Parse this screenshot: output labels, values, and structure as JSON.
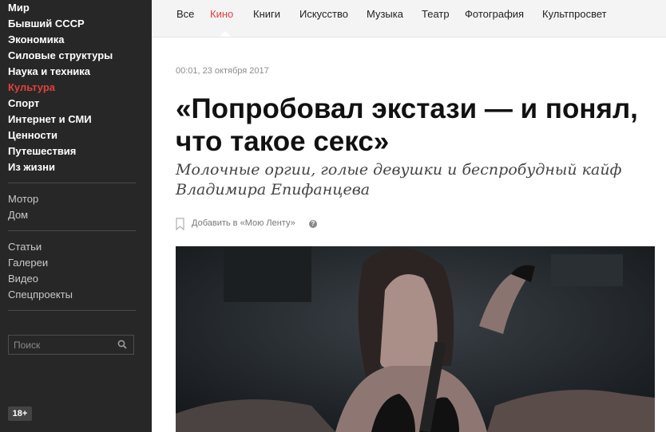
{
  "sidebar": {
    "sections": [
      "Мир",
      "Бывший СССР",
      "Экономика",
      "Силовые структуры",
      "Наука и техника",
      "Культура",
      "Спорт",
      "Интернет и СМИ",
      "Ценности",
      "Путешествия",
      "Из жизни"
    ],
    "active_section": "Культура",
    "extras": [
      "Мотор",
      "Дом"
    ],
    "formats": [
      "Статьи",
      "Галереи",
      "Видео",
      "Спецпроекты"
    ],
    "search_placeholder": "Поиск",
    "age_badge": "18+"
  },
  "topnav": {
    "tabs": [
      "Все",
      "Кино",
      "Книги",
      "Искусство",
      "Музыка",
      "Театр",
      "Фотография",
      "Культпросвет"
    ],
    "active_tab": "Кино"
  },
  "article": {
    "date": "00:01, 23 октября 2017",
    "title": "«Попробовал экстази — и понял, что такое секс»",
    "subtitle": "Молочные оргии, голые девушки и беспробудный кайф Владимира Епифанцева",
    "bookmark_label": "Добавить в «Мою Ленту»",
    "help_mark": "?"
  },
  "colors": {
    "accent": "#e04040",
    "sidebar_bg": "#272727",
    "topbar_bg": "#f4f4f4"
  },
  "icons": {
    "search": "search-icon",
    "bookmark": "bookmark-icon",
    "help": "help-icon"
  }
}
